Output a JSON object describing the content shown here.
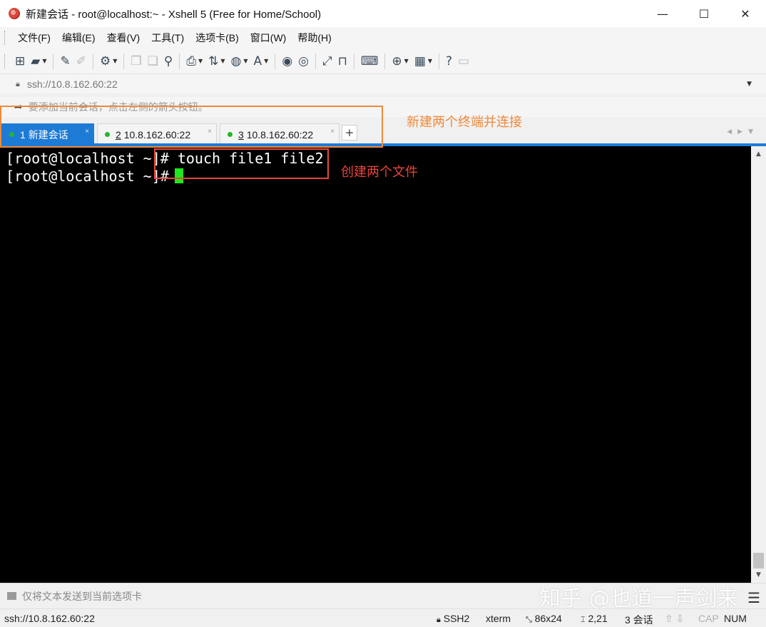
{
  "window": {
    "title": "新建会话 - root@localhost:~ - Xshell 5 (Free for Home/School)",
    "controls": {
      "minimize": "—",
      "maximize": "☐",
      "close": "✕"
    }
  },
  "menu": {
    "items": [
      "文件(F)",
      "编辑(E)",
      "查看(V)",
      "工具(T)",
      "选项卡(B)",
      "窗口(W)",
      "帮助(H)"
    ]
  },
  "toolbar": {
    "icons": [
      "new-session-icon",
      "open-folder-icon",
      "reconnect-icon",
      "disconnect-icon",
      "properties-icon",
      "copy-icon",
      "paste-icon",
      "find-icon",
      "print-icon",
      "transfer-icon",
      "globe-icon",
      "font-icon",
      "xftp-icon",
      "xmanager-icon",
      "fullscreen-icon",
      "lock-icon",
      "keyboard-icon",
      "new-tab-icon",
      "layout-icon",
      "help-icon",
      "chat-icon"
    ]
  },
  "address": {
    "value": "ssh://10.8.162.60:22"
  },
  "hint": {
    "text": "要添加当前会话，点击左侧的箭头按钮。"
  },
  "tabs": [
    {
      "number": "1",
      "label": "新建会话",
      "close": "×",
      "active": true
    },
    {
      "number": "2",
      "label": "10.8.162.60:22",
      "close": "×",
      "active": false
    },
    {
      "number": "3",
      "label": "10.8.162.60:22",
      "close": "×",
      "active": false
    }
  ],
  "tab_add": "+",
  "terminal": {
    "lines": [
      "[root@localhost ~]# touch file1 file2",
      "[root@localhost ~]# "
    ],
    "cursor_color": "#1ee81e"
  },
  "annotations": {
    "tabs_note": "新建两个终端并连接",
    "command_note": "创建两个文件",
    "tabs_color": "#ee8a3c",
    "command_color": "#e8463a"
  },
  "sendbar": {
    "text": "仅将文本发送到当前选项卡"
  },
  "watermark": "知乎 @也道一声剑来",
  "status": {
    "address": "ssh://10.8.162.60:22",
    "protocol": "SSH2",
    "terminal_type": "xterm",
    "size": "86x24",
    "position": "2,21",
    "sessions": "3 会话",
    "caps": "CAP",
    "num": "NUM"
  },
  "colors": {
    "accent": "#1d7bd6",
    "tab_dot": "#1fb82b",
    "terminal_bg": "#000000"
  }
}
